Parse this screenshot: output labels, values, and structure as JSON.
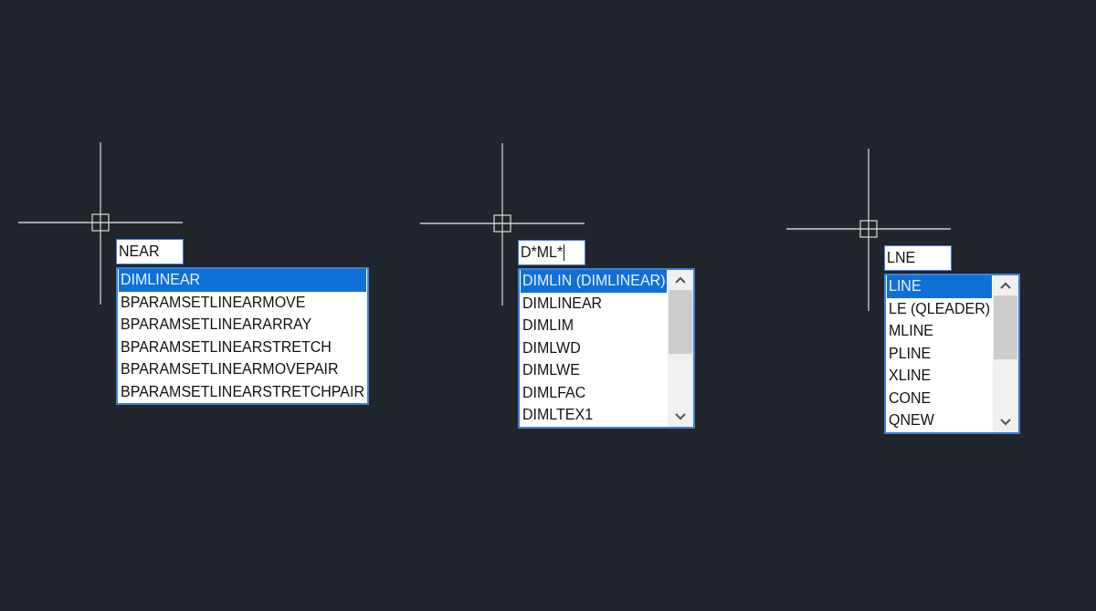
{
  "prompts": [
    {
      "input": "NEAR",
      "scrollable": false,
      "items": [
        {
          "label": "DIMLINEAR",
          "selected": true
        },
        {
          "label": "BPARAMSETLINEARMOVE",
          "selected": false
        },
        {
          "label": "BPARAMSETLINEARARRAY",
          "selected": false
        },
        {
          "label": "BPARAMSETLINEARSTRETCH",
          "selected": false
        },
        {
          "label": "BPARAMSETLINEARMOVEPAIR",
          "selected": false
        },
        {
          "label": "BPARAMSETLINEARSTRETCHPAIR",
          "selected": false
        }
      ]
    },
    {
      "input": "D*ML*",
      "scrollable": true,
      "items": [
        {
          "label": "DIMLIN (DIMLINEAR)",
          "selected": true
        },
        {
          "label": "DIMLINEAR",
          "selected": false
        },
        {
          "label": "DIMLIM",
          "selected": false
        },
        {
          "label": "DIMLWD",
          "selected": false
        },
        {
          "label": "DIMLWE",
          "selected": false
        },
        {
          "label": "DIMLFAC",
          "selected": false
        },
        {
          "label": "DIMLTEX1",
          "selected": false
        }
      ]
    },
    {
      "input": "LNE",
      "scrollable": true,
      "items": [
        {
          "label": "LINE",
          "selected": true
        },
        {
          "label": "LE (QLEADER)",
          "selected": false
        },
        {
          "label": "MLINE",
          "selected": false
        },
        {
          "label": "PLINE",
          "selected": false
        },
        {
          "label": "XLINE",
          "selected": false
        },
        {
          "label": "CONE",
          "selected": false
        },
        {
          "label": "QNEW",
          "selected": false
        }
      ]
    }
  ]
}
